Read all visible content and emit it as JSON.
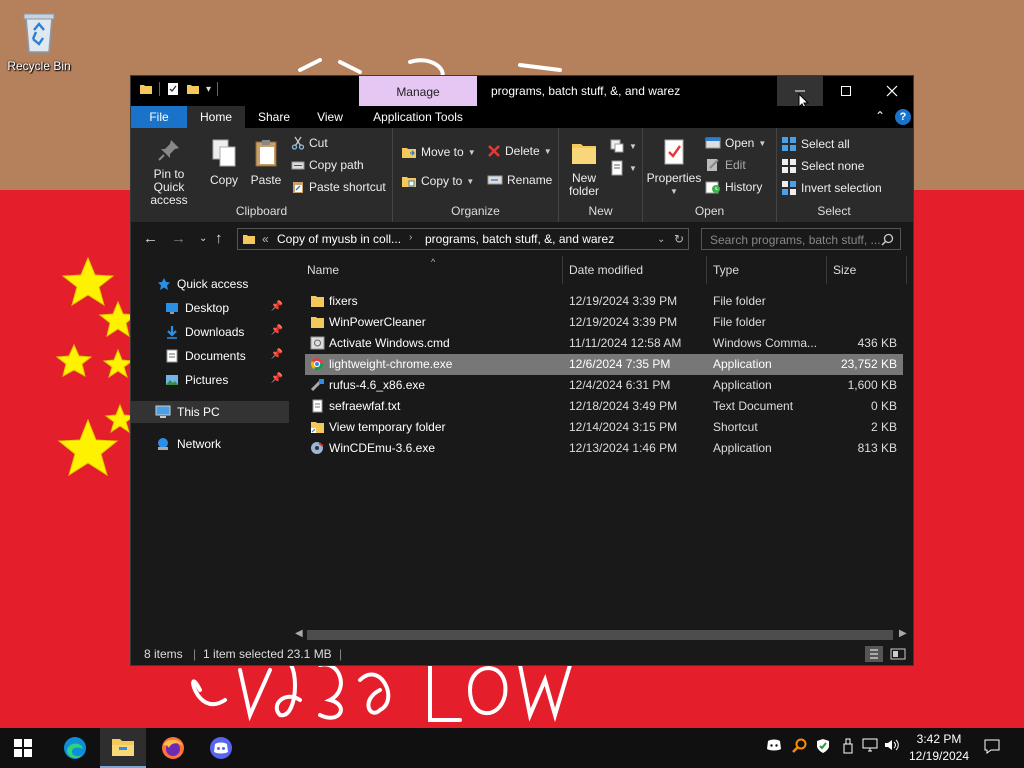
{
  "desktop": {
    "icons": [
      {
        "label": "Recycle Bin",
        "icon": "recycle-bin-icon"
      }
    ]
  },
  "window": {
    "title": "programs, batch stuff, &, and warez",
    "context_tab": "Manage",
    "buttons": {
      "minimize": "–",
      "maximize": "☐",
      "close": "✕"
    },
    "tabs": [
      "File",
      "Home",
      "Share",
      "View",
      "Application Tools"
    ],
    "active_tab": "Home",
    "accent_color": "#1a73c9",
    "manage_color": "#e6c6f2"
  },
  "ribbon": {
    "clipboard": {
      "label": "Clipboard",
      "pin": "Pin to Quick access",
      "copy": "Copy",
      "paste": "Paste",
      "cut": "Cut",
      "copy_path": "Copy path",
      "paste_shortcut": "Paste shortcut"
    },
    "organize": {
      "label": "Organize",
      "move_to": "Move to",
      "copy_to": "Copy to",
      "delete": "Delete",
      "rename": "Rename"
    },
    "new": {
      "label": "New",
      "new_folder": "New folder"
    },
    "open": {
      "label": "Open",
      "properties": "Properties",
      "open": "Open",
      "edit": "Edit",
      "history": "History"
    },
    "select": {
      "label": "Select",
      "select_all": "Select all",
      "select_none": "Select none",
      "invert_selection": "Invert selection"
    }
  },
  "address": {
    "chevron": "«",
    "crumbs": [
      "Copy of myusb in coll...",
      "programs, batch stuff, &, and warez"
    ],
    "search_placeholder": "Search programs, batch stuff, ..."
  },
  "nav": {
    "items": [
      {
        "label": "Quick access",
        "icon": "star-icon"
      },
      {
        "label": "Desktop",
        "icon": "desktop-icon",
        "pinned": true
      },
      {
        "label": "Downloads",
        "icon": "download-icon",
        "pinned": true
      },
      {
        "label": "Documents",
        "icon": "documents-icon",
        "pinned": true
      },
      {
        "label": "Pictures",
        "icon": "pictures-icon",
        "pinned": true
      },
      {
        "label": "This PC",
        "icon": "computer-icon",
        "selected": true
      },
      {
        "label": "Network",
        "icon": "network-icon"
      }
    ]
  },
  "columns": [
    "Name",
    "Date modified",
    "Type",
    "Size"
  ],
  "files": [
    {
      "name": "fixers",
      "date": "12/19/2024 3:39 PM",
      "type": "File folder",
      "size": "",
      "icon": "folder-icon"
    },
    {
      "name": "WinPowerCleaner",
      "date": "12/19/2024 3:39 PM",
      "type": "File folder",
      "size": "",
      "icon": "folder-icon"
    },
    {
      "name": "Activate Windows.cmd",
      "date": "11/11/2024 12:58 AM",
      "type": "Windows Comma...",
      "size": "436 KB",
      "icon": "cmd-file-icon"
    },
    {
      "name": "lightweight-chrome.exe",
      "date": "12/6/2024 7:35 PM",
      "type": "Application",
      "size": "23,752 KB",
      "icon": "chrome-icon",
      "selected": true
    },
    {
      "name": "rufus-4.6_x86.exe",
      "date": "12/4/2024 6:31 PM",
      "type": "Application",
      "size": "1,600 KB",
      "icon": "rufus-icon"
    },
    {
      "name": "sefraewfaf.txt",
      "date": "12/18/2024 3:49 PM",
      "type": "Text Document",
      "size": "0 KB",
      "icon": "text-file-icon"
    },
    {
      "name": "View temporary folder",
      "date": "12/14/2024 3:15 PM",
      "type": "Shortcut",
      "size": "2 KB",
      "icon": "shortcut-icon"
    },
    {
      "name": "WinCDEmu-3.6.exe",
      "date": "12/13/2024 1:46 PM",
      "type": "Application",
      "size": "813 KB",
      "icon": "wincdemu-icon"
    }
  ],
  "status": {
    "count": "8 items",
    "selection": "1 item selected",
    "size": "23.1 MB"
  },
  "taskbar": {
    "apps": [
      "windows-start-icon",
      "edge-icon",
      "file-explorer-icon",
      "firefox-icon",
      "discord-icon"
    ],
    "time": "3:42 PM",
    "date": "12/19/2024"
  }
}
